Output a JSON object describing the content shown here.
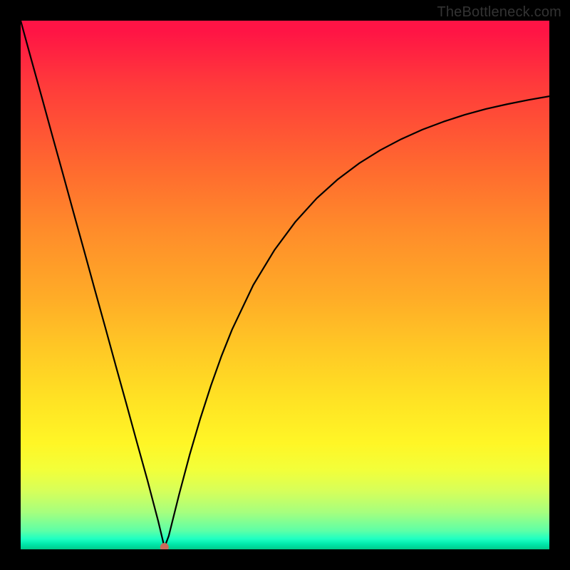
{
  "watermark": "TheBottleneck.com",
  "chart_data": {
    "type": "line",
    "title": "",
    "xlabel": "",
    "ylabel": "",
    "xlim": [
      0,
      100
    ],
    "ylim": [
      0,
      100
    ],
    "legend": false,
    "grid": false,
    "background": "vertical gradient red→orange→yellow→green",
    "marker": {
      "x": 27.2,
      "y": 0.4,
      "color": "#cc6a5a"
    },
    "series": [
      {
        "name": "bottleneck-curve",
        "x": [
          0,
          2,
          4,
          6,
          8,
          10,
          12,
          14,
          16,
          18,
          20,
          22,
          24,
          25,
          26,
          27.2,
          28,
          30,
          32,
          34,
          36,
          38,
          40,
          44,
          48,
          52,
          56,
          60,
          64,
          68,
          72,
          76,
          80,
          84,
          88,
          92,
          96,
          100
        ],
        "y": [
          100,
          92.7,
          85.5,
          78.2,
          71.0,
          63.7,
          56.5,
          49.2,
          42.0,
          34.7,
          27.5,
          20.2,
          13.0,
          9.2,
          5.4,
          0.4,
          2.5,
          10.5,
          18.0,
          24.8,
          31.0,
          36.6,
          41.6,
          50.0,
          56.6,
          62.0,
          66.4,
          70.0,
          73.0,
          75.5,
          77.6,
          79.4,
          80.9,
          82.2,
          83.3,
          84.2,
          85.0,
          85.7
        ]
      }
    ]
  }
}
